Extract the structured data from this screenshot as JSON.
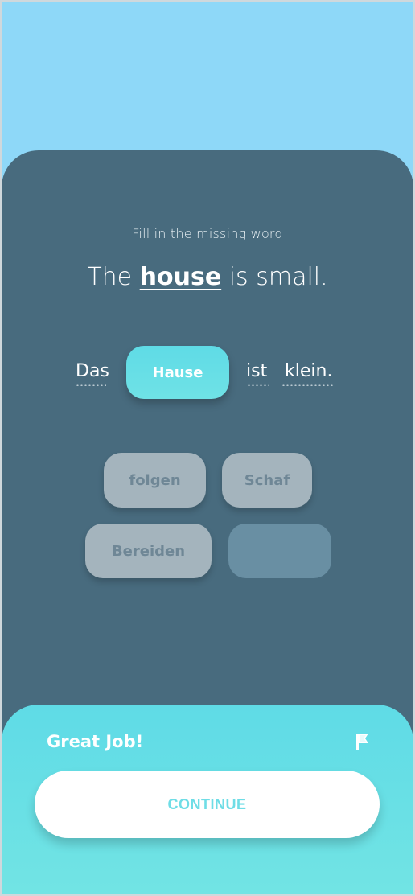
{
  "exercise": {
    "instruction": "Fill in the missing word",
    "sentence_before": "The ",
    "sentence_highlight": "house",
    "sentence_after": " is small.",
    "translation_words": [
      "Das",
      "ist",
      "klein."
    ],
    "selected_answer": "Hause"
  },
  "options": [
    "folgen",
    "Schaf",
    "Bereiden"
  ],
  "feedback": {
    "message": "Great Job!",
    "continue_label": "CONTINUE",
    "flag_icon": "flag-icon"
  },
  "colors": {
    "background": "#8ed8f8",
    "card": "#486b7e",
    "accent": "#5fdbe6",
    "option": "#a4b4bd"
  }
}
